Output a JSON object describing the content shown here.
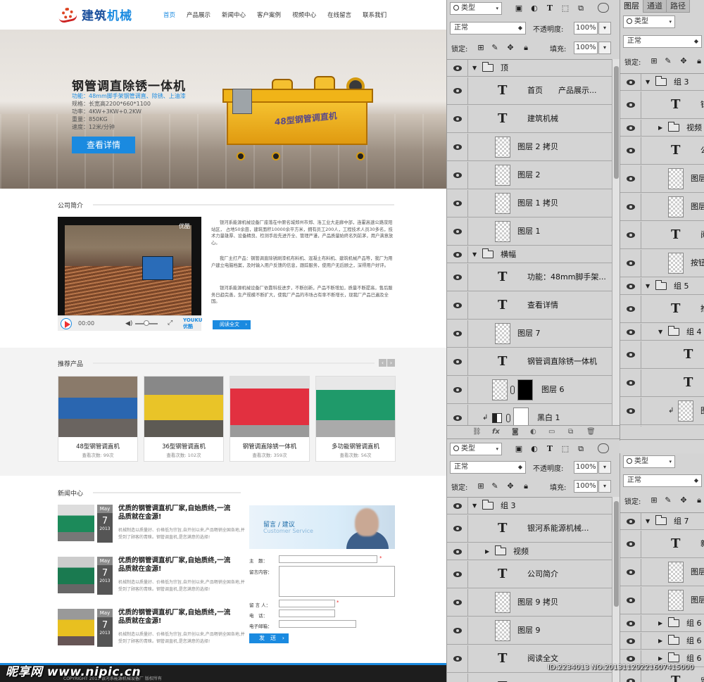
{
  "site": {
    "logo_text_a": "建筑",
    "logo_text_b": "机械",
    "nav": [
      "首页",
      "产品展示",
      "新闻中心",
      "客户案例",
      "视频中心",
      "在线留言",
      "联系我们"
    ],
    "banner": {
      "title": "钢管调直除锈一体机",
      "func": "功能：48mm脚手架钢管调直、除锈、上油漆",
      "specs": [
        "规格：长宽高2200*660*1100",
        "功率：4KW+3KW+0.2KW",
        "重量：850KG",
        "速度：12米/分钟"
      ],
      "button": "查看详情",
      "machine_label": "48型钢管调直机"
    },
    "company": {
      "heading": "公司简介",
      "video_brand": "优酷",
      "video_time": "00:00",
      "video_brand2": "YOUKU 优酷",
      "para1": "银河系能源机械设备厂座落在中原名城郑州市郑、洛工业大走廊中部，连霍高速公路荥阳站区， 占地50余亩，建筑面积10000余平方米，拥有员工200人，工程技术人员30多名，技术力量雄厚、设备精良、检测手段先进齐全、管理严谨，产品质量始终名列前茅，用户满意放心。",
      "para2": "我厂主打产品：钢管调直除锈刷漆机布料机、混凝土布料机、建筑机械产品等，我厂为用户建立电脑档案，及时输入用户反馈的信息，跟踪服务，使用户无后顾之，深得用户好评。",
      "para3": "银河系能源机械设备厂依靠科技进步，不断创新，产品不断增加，质量不断提高，售后服务日趋完善，生产规模不断扩大，使我厂产品的市场占有率不断增长，现我厂产品已遍及全国。",
      "more": "阅读全文"
    },
    "recommend": {
      "heading": "推荐产品",
      "products": [
        {
          "name": "48型钢管调直机",
          "views": "查看次数: 99次"
        },
        {
          "name": "36型钢管调直机",
          "views": "查看次数: 102次"
        },
        {
          "name": "钢管调直除锈一体机",
          "views": "查看次数: 359次"
        },
        {
          "name": "多功能钢管调直机",
          "views": "查看次数: 56次"
        }
      ]
    },
    "news": {
      "heading": "新闻中心",
      "items": [
        {
          "title": "优质的钢管调直机厂家,自始质终,一流品质就在金源!",
          "text": "机械制造以质量好、价格低为宗旨,自开创以来,产品畅销全国各地,并受到了顾客的青睐。钢管调直机,是您满意的选择!",
          "month": "May",
          "day": "7",
          "year": "2013"
        },
        {
          "title": "优质的钢管调直机厂家,自始质终,一流品质就在金源!",
          "text": "机械制造以质量好、价格低为宗旨,自开创以来,产品畅销全国各地,并受到了顾客的青睐。钢管调直机,是您满意的选择!",
          "month": "May",
          "day": "7",
          "year": "2013"
        },
        {
          "title": "优质的钢管调直机厂家,自始质终,一流品质就在金源!",
          "text": "机械制造以质量好、价格低为宗旨,自开创以来,产品畅销全国各地,并受到了顾客的青睐。钢管调直机,是您满意的选择!",
          "month": "May",
          "day": "7",
          "year": "2013"
        }
      ]
    },
    "guestbook": {
      "title": "留言 / 建议",
      "subtitle": "Customer Service",
      "subject": "主　题：",
      "content": "留言内容：",
      "person": "留 言 人：",
      "phone": "电　话：",
      "email": "电子邮箱：",
      "required": "*",
      "send": "发　送"
    },
    "footer": "COPYRIGHT 2013 银河系能源机械设备厂 版权所有"
  },
  "watermark": "昵享网 www.nipic.cn",
  "id_watermark": "ID:2234013 NO:20131129221607415000",
  "ps": {
    "kind_label": "类型",
    "blend_mode": "正常",
    "opacity_label": "不透明度:",
    "opacity_value": "100%",
    "lock_label": "锁定:",
    "fill_label": "填充:",
    "fill_value": "100%",
    "tabs": [
      "图层",
      "通道",
      "路径"
    ],
    "panel1_layers": [
      {
        "kind": "group",
        "name": "顶",
        "indent": 0,
        "open": true
      },
      {
        "kind": "text",
        "name": "首页　　产品展示...",
        "indent": 1
      },
      {
        "kind": "text",
        "name": "建筑机械",
        "indent": 1
      },
      {
        "kind": "pixel",
        "name": "图层 2 拷贝",
        "indent": 1
      },
      {
        "kind": "pixel",
        "name": "图层 2",
        "indent": 1
      },
      {
        "kind": "pixel",
        "name": "图层 1 拷贝",
        "indent": 1
      },
      {
        "kind": "pixel",
        "name": "图层 1",
        "indent": 1
      },
      {
        "kind": "group",
        "name": "横幅",
        "indent": 0,
        "open": true
      },
      {
        "kind": "text",
        "name": "功能：48mm脚手架...",
        "indent": 1
      },
      {
        "kind": "text",
        "name": "查看详情",
        "indent": 1
      },
      {
        "kind": "pixel",
        "name": "图层 7",
        "indent": 1
      },
      {
        "kind": "text",
        "name": "钢管调直除锈一体机",
        "indent": 1
      },
      {
        "kind": "masked",
        "name": "图层 6",
        "indent": 1
      },
      {
        "kind": "adjust",
        "name": "黑白 1",
        "indent": 1
      }
    ],
    "panel2_layers": [
      {
        "kind": "group",
        "name": "组 3",
        "indent": 0,
        "open": true
      },
      {
        "kind": "text",
        "name": "银河系能源机械...",
        "indent": 1
      },
      {
        "kind": "group",
        "name": "视频",
        "indent": 1,
        "open": false
      },
      {
        "kind": "text",
        "name": "公司简介",
        "indent": 1
      },
      {
        "kind": "pixel",
        "name": "图层 9 拷贝",
        "indent": 1
      },
      {
        "kind": "pixel",
        "name": "图层 9",
        "indent": 1
      },
      {
        "kind": "text",
        "name": "阅读全文",
        "indent": 1
      },
      {
        "kind": "text",
        "name": "按钮",
        "indent": 1
      }
    ],
    "panel3_layers": [
      {
        "kind": "group",
        "name": "组 3",
        "indent": 0,
        "open": true
      },
      {
        "kind": "text",
        "name": "银",
        "indent": 1
      },
      {
        "kind": "group",
        "name": "视频",
        "indent": 1,
        "open": false
      },
      {
        "kind": "text",
        "name": "公司简",
        "indent": 1
      },
      {
        "kind": "pixel",
        "name": "图层 9",
        "indent": 1
      },
      {
        "kind": "pixel",
        "name": "图层 9",
        "indent": 1
      },
      {
        "kind": "text",
        "name": "阅读全",
        "indent": 1
      },
      {
        "kind": "pixel",
        "name": "按钮",
        "indent": 1
      },
      {
        "kind": "group",
        "name": "组 5",
        "indent": 0,
        "open": true
      },
      {
        "kind": "text",
        "name": "推荐产",
        "indent": 1
      },
      {
        "kind": "group",
        "name": "组 4 拷",
        "indent": 1,
        "open": true
      },
      {
        "kind": "text",
        "name": "查",
        "indent": 2
      },
      {
        "kind": "text",
        "name": "多",
        "indent": 2
      },
      {
        "kind": "clip",
        "name": "图",
        "indent": 2
      },
      {
        "kind": "pixel",
        "name": "图层",
        "indent": 2
      }
    ],
    "panel4_layers": [
      {
        "kind": "group",
        "name": "组 7",
        "indent": 0,
        "open": true
      },
      {
        "kind": "text",
        "name": "新闻中",
        "indent": 1
      },
      {
        "kind": "pixel",
        "name": "图层 9",
        "indent": 1
      },
      {
        "kind": "pixel",
        "name": "图层 9",
        "indent": 1
      },
      {
        "kind": "group",
        "name": "组 6",
        "indent": 1,
        "open": false
      },
      {
        "kind": "group",
        "name": "组 6 拷",
        "indent": 1,
        "open": false
      },
      {
        "kind": "group",
        "name": "组 6",
        "indent": 1,
        "open": false
      },
      {
        "kind": "text",
        "name": "留言",
        "indent": 1
      }
    ]
  }
}
